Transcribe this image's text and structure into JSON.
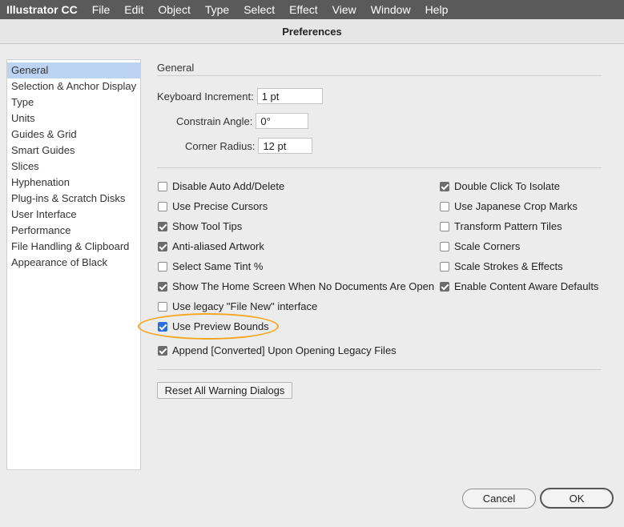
{
  "menubar": {
    "app": "Illustrator CC",
    "items": [
      "File",
      "Edit",
      "Object",
      "Type",
      "Select",
      "Effect",
      "View",
      "Window",
      "Help"
    ]
  },
  "dialog": {
    "title": "Preferences"
  },
  "sidebar": {
    "items": [
      {
        "label": "General",
        "selected": true
      },
      {
        "label": "Selection & Anchor Display"
      },
      {
        "label": "Type"
      },
      {
        "label": "Units"
      },
      {
        "label": "Guides & Grid"
      },
      {
        "label": "Smart Guides"
      },
      {
        "label": "Slices"
      },
      {
        "label": "Hyphenation"
      },
      {
        "label": "Plug-ins & Scratch Disks"
      },
      {
        "label": "User Interface"
      },
      {
        "label": "Performance"
      },
      {
        "label": "File Handling & Clipboard"
      },
      {
        "label": "Appearance of Black"
      }
    ]
  },
  "general": {
    "section_title": "General",
    "keyboard_increment": {
      "label": "Keyboard Increment:",
      "value": "1 pt"
    },
    "constrain_angle": {
      "label": "Constrain Angle:",
      "value": "0°"
    },
    "corner_radius": {
      "label": "Corner Radius:",
      "value": "12 pt"
    },
    "left_options": [
      {
        "label": "Disable Auto Add/Delete",
        "checked": false
      },
      {
        "label": "Use Precise Cursors",
        "checked": false
      },
      {
        "label": "Show Tool Tips",
        "checked": true
      },
      {
        "label": "Anti-aliased Artwork",
        "checked": true
      },
      {
        "label": "Select Same Tint %",
        "checked": false
      },
      {
        "label": "Show The Home Screen When No Documents Are Open",
        "checked": true
      },
      {
        "label": "Use legacy \"File New\" interface",
        "checked": false
      },
      {
        "label": "Use Preview Bounds",
        "checked": true,
        "highlighted": true
      },
      {
        "label": "Append [Converted] Upon Opening Legacy Files",
        "checked": true
      }
    ],
    "right_options": [
      {
        "label": "Double Click To Isolate",
        "checked": true
      },
      {
        "label": "Use Japanese Crop Marks",
        "checked": false
      },
      {
        "label": "Transform Pattern Tiles",
        "checked": false
      },
      {
        "label": "Scale Corners",
        "checked": false
      },
      {
        "label": "Scale Strokes & Effects",
        "checked": false
      },
      {
        "label": "Enable Content Aware Defaults",
        "checked": true
      }
    ],
    "reset_button": "Reset All Warning Dialogs"
  },
  "buttons": {
    "cancel": "Cancel",
    "ok": "OK"
  },
  "colors": {
    "highlight": "#f5a623",
    "selection": "#bcd3f1",
    "checkbox_blue": "#2a6fdb"
  }
}
